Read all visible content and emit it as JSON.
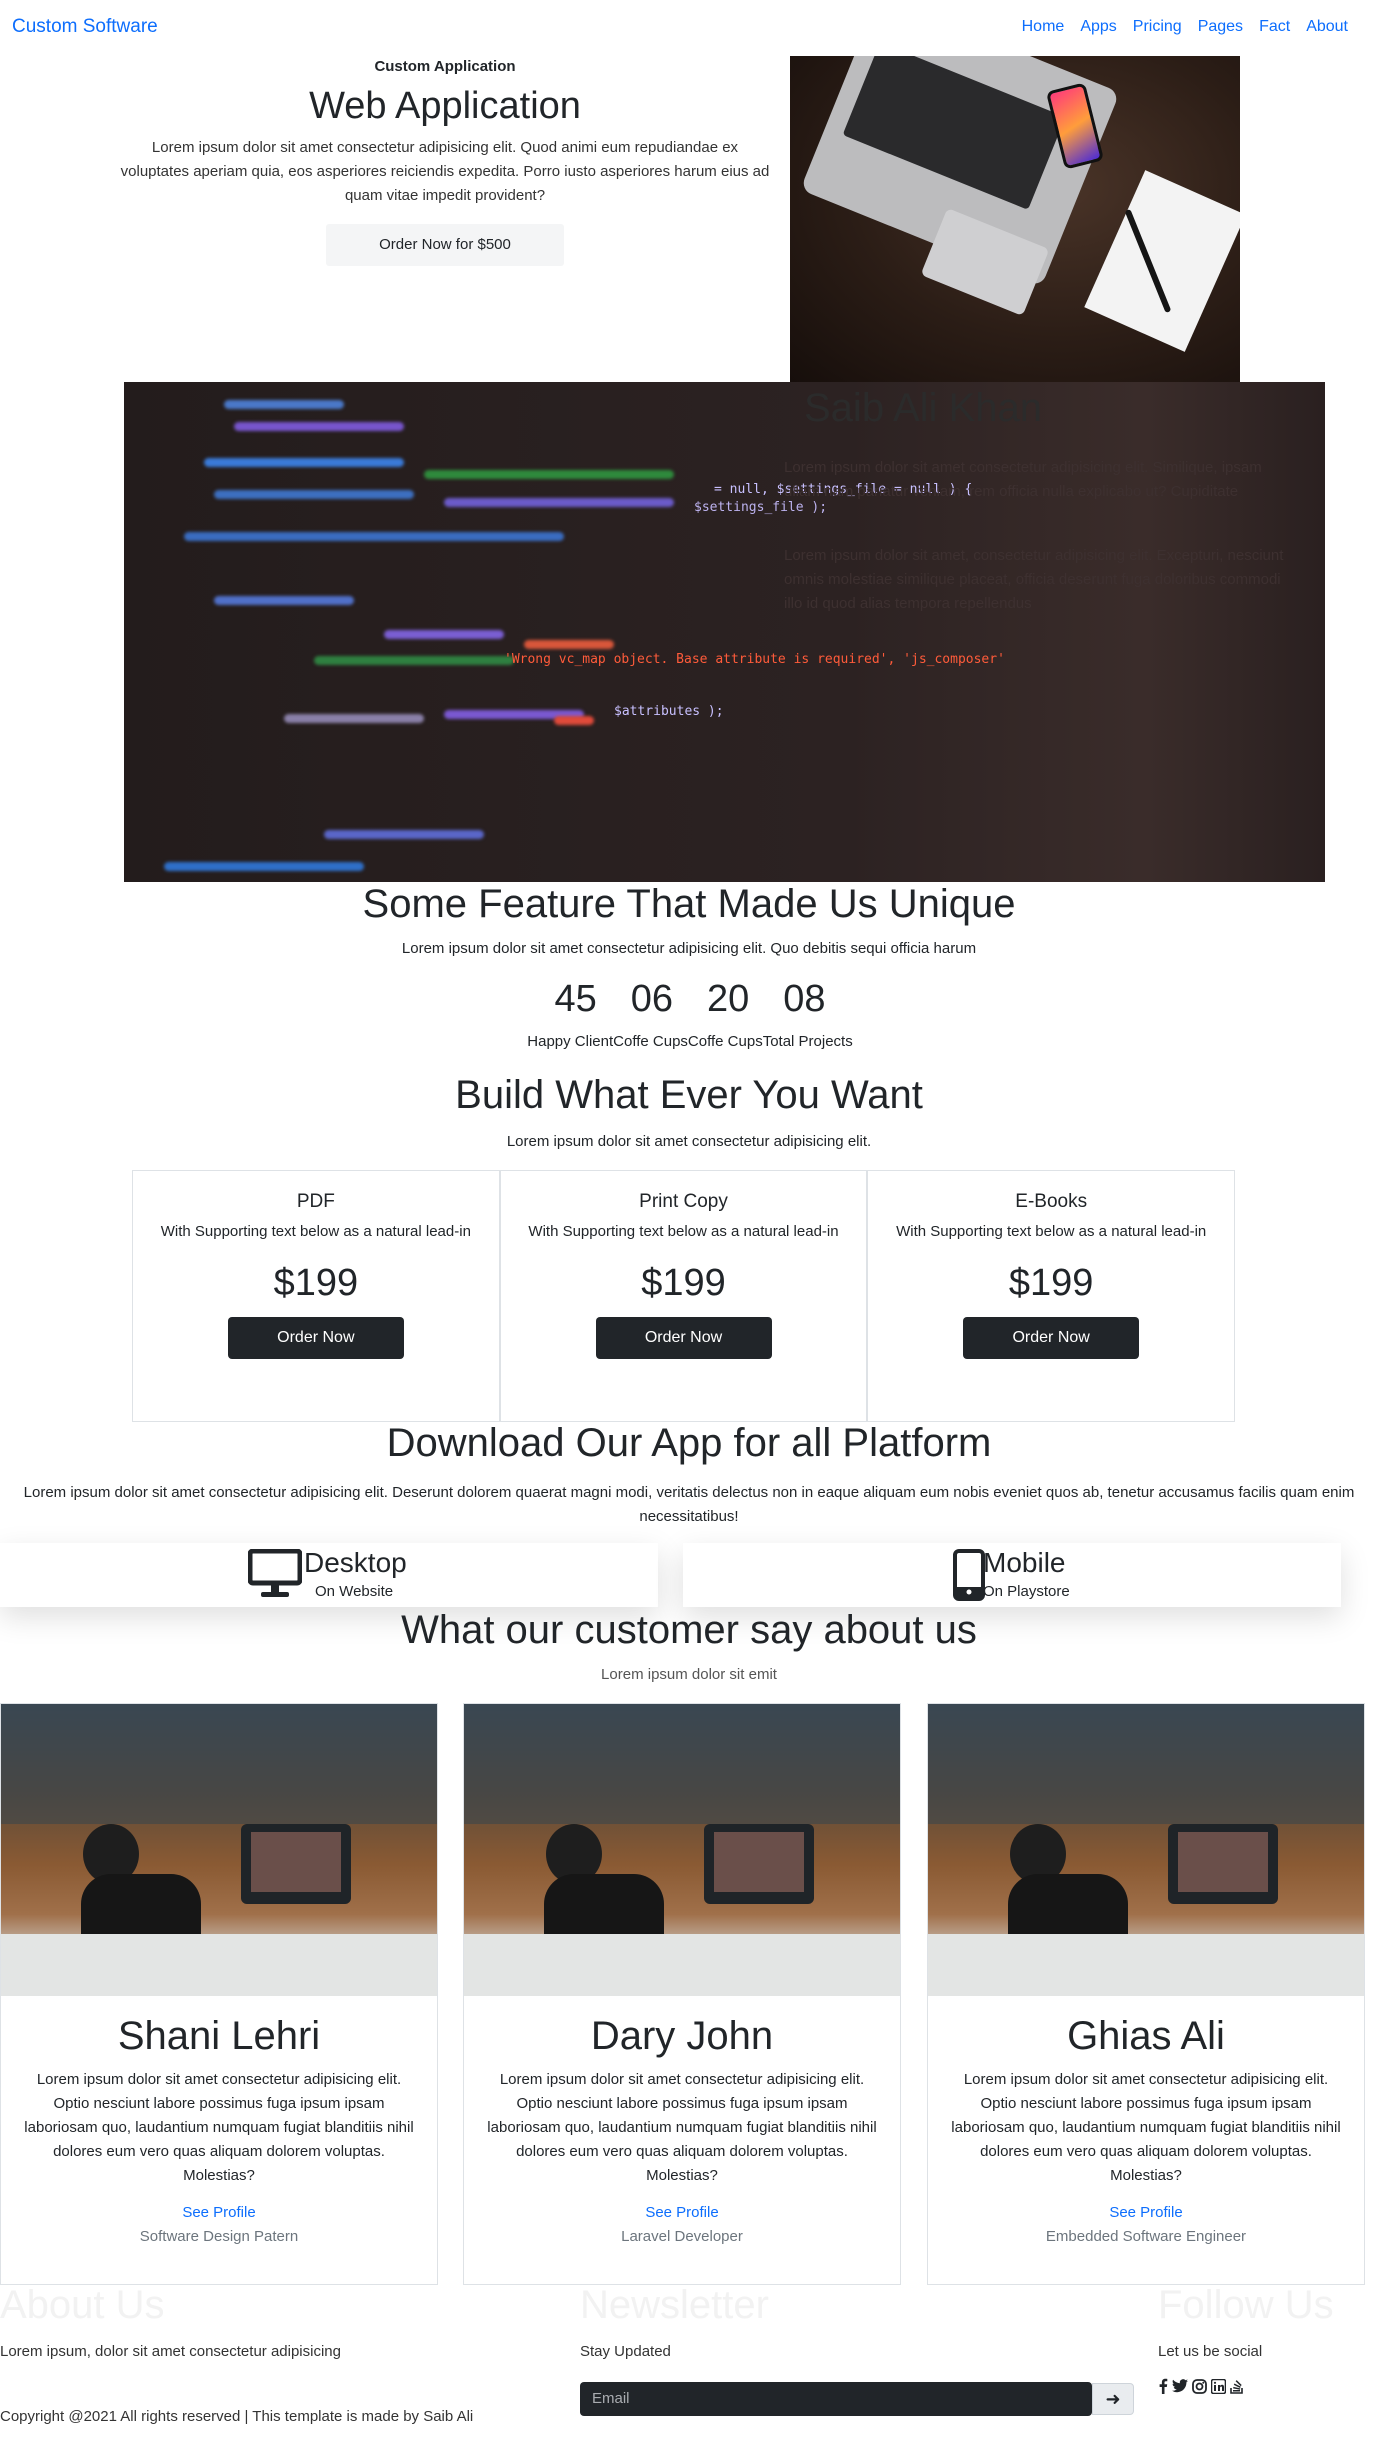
{
  "nav": {
    "brand": "Custom Software",
    "links": [
      "Home",
      "Apps",
      "Pricing",
      "Pages",
      "Fact",
      "About"
    ]
  },
  "hero": {
    "eyebrow": "Custom Application",
    "title": "Web Application",
    "desc": "Lorem ipsum dolor sit amet consectetur adipisicing elit. Quod animi eum repudiandae ex voluptates aperiam quia, eos asperiores reiciendis expedita. Porro iusto asperiores harum eius ad quam vitae impedit provident?",
    "button": "Order Now for $500"
  },
  "banner": {
    "title": "Saib Ali Khan",
    "p1": "Lorem ipsum dolor sit amet consectetur adipisicing elit. Similique, ipsam ullam nam pariatur veniam, rem officia nulla explicabo ut? Cupiditate",
    "p2": "Lorem ipsum dolor sit amet, consectetur adipisicing elit. Excepturi, nesciunt omnis molestiae similique placeat, officia deserunt fuga doloribus commodi illo id quod alias tempora repellendus"
  },
  "features": {
    "title": "Some Feature That Made Us Unique",
    "sub": "Lorem ipsum dolor sit amet consectetur adipisicing elit. Quo debitis sequi officia harum",
    "counters": [
      {
        "value": "45",
        "label": "Happy Client"
      },
      {
        "value": "06",
        "label": "Coffe Cups"
      },
      {
        "value": "20",
        "label": "Coffe Cups"
      },
      {
        "value": "08",
        "label": "Total Projects"
      }
    ]
  },
  "pricing": {
    "title": "Build What Ever You Want",
    "sub": "Lorem ipsum dolor sit amet consectetur adipisicing elit.",
    "plans": [
      {
        "name": "PDF",
        "text": "With Supporting text below as a natural lead-in",
        "price": "$199",
        "button": "Order Now"
      },
      {
        "name": "Print Copy",
        "text": "With Supporting text below as a natural lead-in",
        "price": "$199",
        "button": "Order Now"
      },
      {
        "name": "E-Books",
        "text": "With Supporting text below as a natural lead-in",
        "price": "$199",
        "button": "Order Now"
      }
    ]
  },
  "download": {
    "title": "Download Our App for all Platform",
    "desc": "Lorem ipsum dolor sit amet consectetur adipisicing elit. Deserunt dolorem quaerat magni modi, veritatis delectus non in eaque aliquam eum nobis eveniet quos ab, tenetur accusamus facilis quam enim necessitatibus!",
    "platforms": [
      {
        "name": "Desktop",
        "sub": "On Website",
        "icon": "desktop-icon"
      },
      {
        "name": "Mobile",
        "sub": "On Playstore",
        "icon": "mobile-icon"
      }
    ]
  },
  "customers": {
    "title": "What our customer say about us",
    "sub": "Lorem ipsum dolor sit emit",
    "items": [
      {
        "name": "Shani Lehri",
        "text": "Lorem ipsum dolor sit amet consectetur adipisicing elit. Optio nesciunt labore possimus fuga ipsum ipsam laboriosam quo, laudantium numquam fugiat blanditiis nihil dolores eum vero quas aliquam dolorem voluptas. Molestias?",
        "link": "See Profile",
        "role": "Software Design Patern"
      },
      {
        "name": "Dary John",
        "text": "Lorem ipsum dolor sit amet consectetur adipisicing elit. Optio nesciunt labore possimus fuga ipsum ipsam laboriosam quo, laudantium numquam fugiat blanditiis nihil dolores eum vero quas aliquam dolorem voluptas. Molestias?",
        "link": "See Profile",
        "role": "Laravel Developer"
      },
      {
        "name": "Ghias Ali",
        "text": "Lorem ipsum dolor sit amet consectetur adipisicing elit. Optio nesciunt labore possimus fuga ipsum ipsam laboriosam quo, laudantium numquam fugiat blanditiis nihil dolores eum vero quas aliquam dolorem voluptas. Molestias?",
        "link": "See Profile",
        "role": "Embedded Software Engineer"
      }
    ]
  },
  "footer": {
    "about_head": "About Us",
    "about_text": "Lorem ipsum, dolor sit amet consectetur adipisicing",
    "news_head": "Newsletter",
    "news_text": "Stay Updated",
    "email_placeholder": "Email",
    "follow_head": "Follow Us",
    "follow_text": "Let us be social",
    "social_icons": [
      "facebook-icon",
      "twitter-icon",
      "instagram-icon",
      "linkedin-icon",
      "stackoverflow-icon"
    ],
    "copyright": "Copyright @2021 All rights reserved | This template is made by Saib Ali"
  }
}
